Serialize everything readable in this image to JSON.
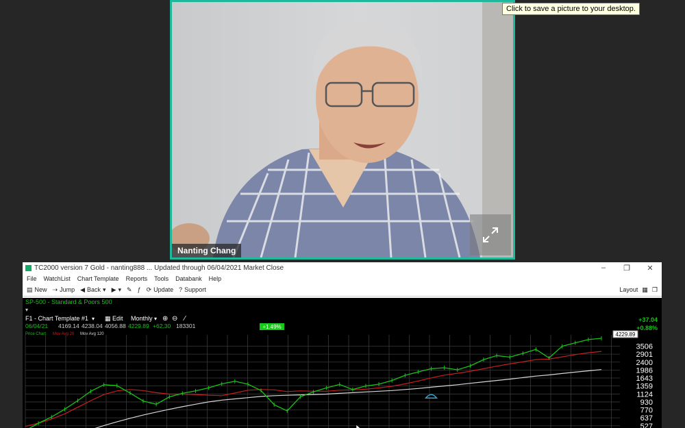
{
  "tooltip": "Click to save a picture to your desktop.",
  "video": {
    "participant_name": "Nanting Chang"
  },
  "app": {
    "title": "TC2000 version 7 Gold - nanting888  ... Updated through 06/04/2021  Market Close",
    "window_controls": [
      "–",
      "❐",
      "✕"
    ],
    "menu": [
      "File",
      "WatchList",
      "Chart Template",
      "Reports",
      "Tools",
      "Databank",
      "Help"
    ],
    "toolbar": {
      "new": "New",
      "jump": "Jump",
      "back": "Back",
      "update": "Update",
      "support": "Support",
      "layout": "Layout"
    }
  },
  "chart_header": {
    "symbol_title": "SP-500 - Standard & Poors 500",
    "template": "F1 - Chart Template #1",
    "edit": "Edit",
    "period": "Monthly",
    "ohlc": {
      "date": "06/04/21",
      "open": "4169.14",
      "high": "4238.04",
      "low": "4056.88",
      "close": "4229.89",
      "change": "+62.30",
      "volume": "183301"
    },
    "indicator_labels": [
      "Price Chart",
      "Mov Avg 20",
      "Mov Avg 120"
    ],
    "pct_box": "+1.49%",
    "net_change": "+37.04",
    "net_pct": "+0.88%",
    "last_price_label": "4229.89"
  },
  "colors": {
    "price": "#19c219",
    "ma20": "#c81e1e",
    "ma120": "#d8d8d8",
    "marker": "#3aa0c8",
    "accent": "#1fb89a"
  },
  "chart_data": {
    "type": "line",
    "title": "SP-500 - Standard & Poors 500",
    "yaxis_scale": "log",
    "ytick_labels": [
      "3506",
      "2901",
      "2400",
      "1986",
      "1643",
      "1359",
      "1124",
      "930",
      "770",
      "637",
      "527"
    ],
    "ylim": [
      500,
      4300
    ],
    "series": [
      {
        "name": "Price Chart",
        "values": [
          470,
          560,
          650,
          780,
          960,
          1200,
          1400,
          1370,
          1150,
          950,
          880,
          1050,
          1140,
          1210,
          1300,
          1430,
          1520,
          1420,
          1220,
          870,
          750,
          1050,
          1180,
          1300,
          1410,
          1250,
          1360,
          1420,
          1550,
          1750,
          1900,
          2050,
          2100,
          2000,
          2200,
          2550,
          2800,
          2700,
          2950,
          3250,
          2650,
          3500,
          3800,
          4100,
          4229.89
        ]
      },
      {
        "name": "Mov Avg 20",
        "values": [
          520,
          560,
          620,
          700,
          820,
          960,
          1110,
          1210,
          1250,
          1220,
          1160,
          1120,
          1120,
          1110,
          1090,
          1080,
          1150,
          1230,
          1250,
          1240,
          1190,
          1210,
          1200,
          1200,
          1230,
          1240,
          1260,
          1300,
          1350,
          1430,
          1530,
          1650,
          1760,
          1840,
          1930,
          2050,
          2180,
          2300,
          2420,
          2550,
          2580,
          2720,
          2870,
          3000,
          3100
        ]
      },
      {
        "name": "Mov Avg 120",
        "values": [
          300,
          330,
          360,
          400,
          440,
          480,
          530,
          580,
          630,
          680,
          730,
          780,
          830,
          880,
          930,
          970,
          1000,
          1030,
          1060,
          1080,
          1090,
          1100,
          1110,
          1120,
          1140,
          1160,
          1180,
          1200,
          1220,
          1250,
          1280,
          1320,
          1360,
          1400,
          1450,
          1500,
          1550,
          1600,
          1660,
          1720,
          1770,
          1830,
          1890,
          1950,
          2010
        ]
      }
    ]
  }
}
